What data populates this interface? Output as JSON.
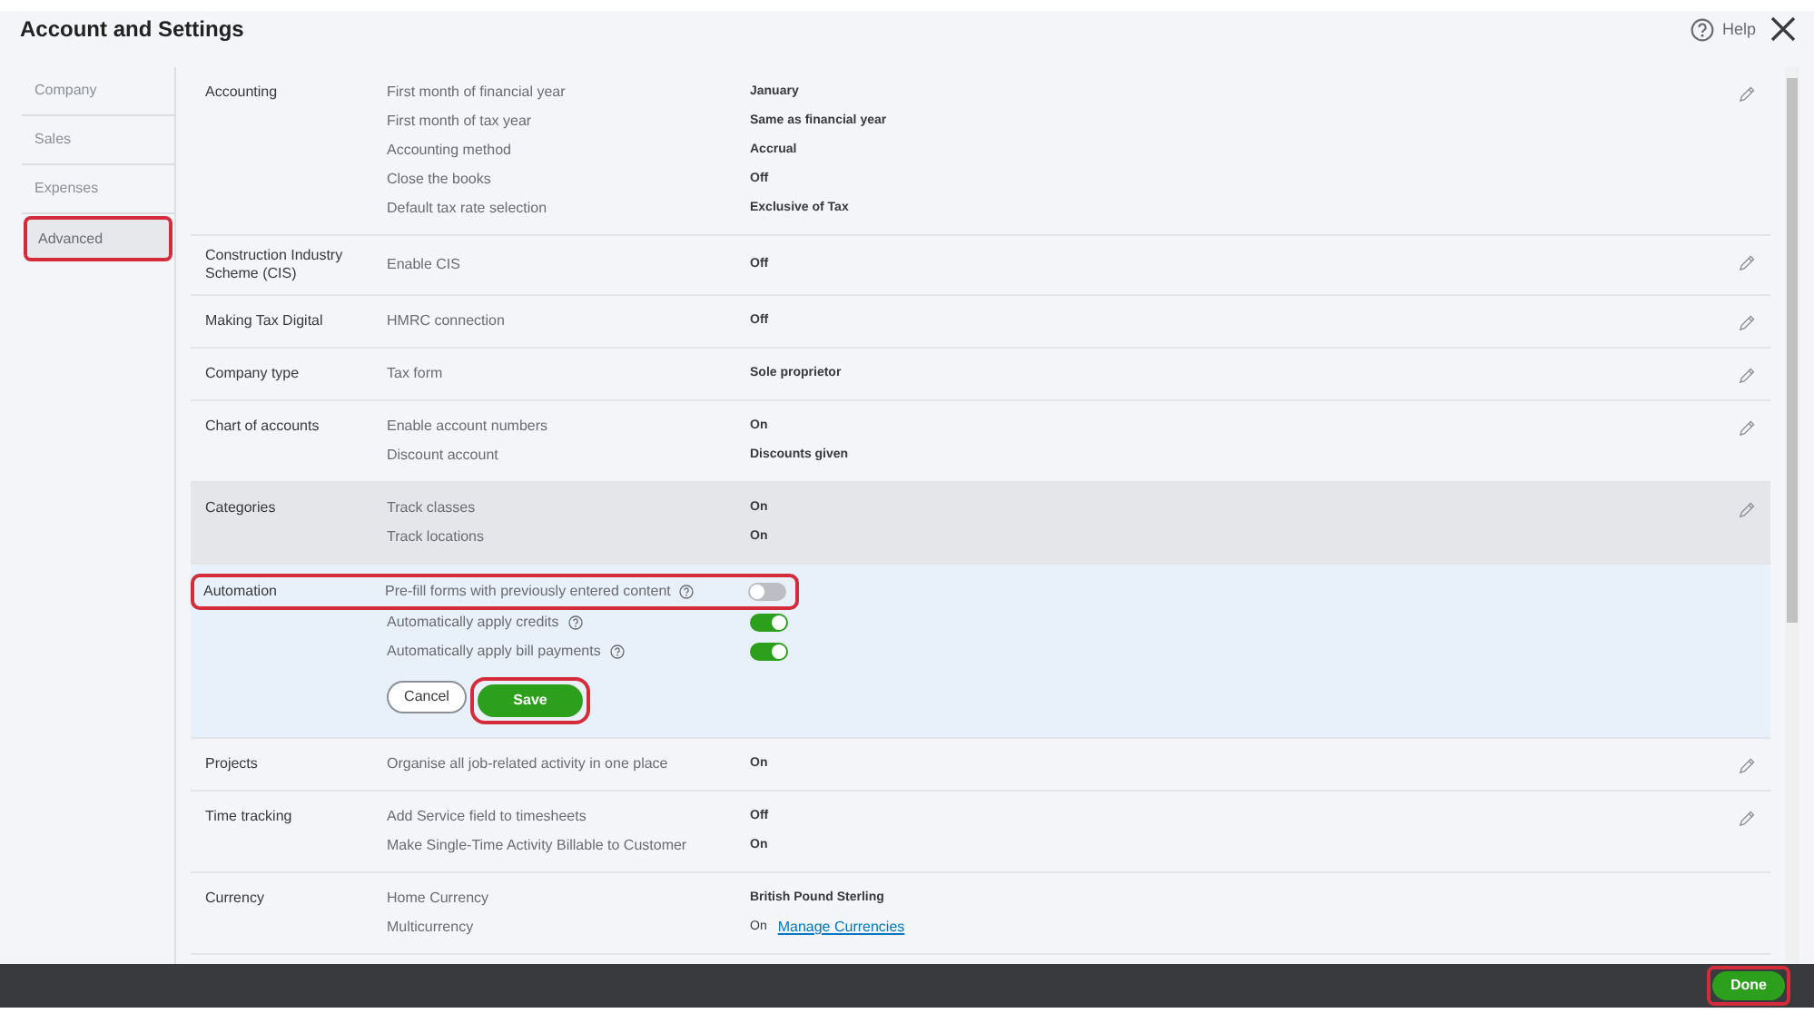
{
  "window": {
    "title": "Account and Settings",
    "help": "Help"
  },
  "sidebar": {
    "items": [
      {
        "label": "Company",
        "selected": false,
        "annotated": false
      },
      {
        "label": "Sales",
        "selected": false,
        "annotated": false
      },
      {
        "label": "Expenses",
        "selected": false,
        "annotated": false
      },
      {
        "label": "Advanced",
        "selected": true,
        "annotated": true
      }
    ]
  },
  "sections": [
    {
      "title": "Accounting",
      "hovered": false,
      "editing": false,
      "editable": true,
      "rows": [
        {
          "kind": "value",
          "label": "First month of financial year",
          "value": "January"
        },
        {
          "kind": "value",
          "label": "First month of tax year",
          "value": "Same as financial year"
        },
        {
          "kind": "value",
          "label": "Accounting method",
          "value": "Accrual"
        },
        {
          "kind": "value",
          "label": "Close the books",
          "value": "Off"
        },
        {
          "kind": "value",
          "label": "Default tax rate selection",
          "value": "Exclusive of Tax"
        }
      ]
    },
    {
      "title": "Construction Industry Scheme (CIS)",
      "hovered": false,
      "editing": false,
      "editable": true,
      "rows": [
        {
          "kind": "value",
          "label": "Enable CIS",
          "value": "Off"
        }
      ]
    },
    {
      "title": "Making Tax Digital",
      "hovered": false,
      "editing": false,
      "editable": true,
      "rows": [
        {
          "kind": "value",
          "label": "HMRC connection",
          "value": "Off"
        }
      ]
    },
    {
      "title": "Company type",
      "hovered": false,
      "editing": false,
      "editable": true,
      "rows": [
        {
          "kind": "value",
          "label": "Tax form",
          "value": "Sole proprietor"
        }
      ]
    },
    {
      "title": "Chart of accounts",
      "hovered": false,
      "editing": false,
      "editable": true,
      "rows": [
        {
          "kind": "value",
          "label": "Enable account numbers",
          "value": "On"
        },
        {
          "kind": "value",
          "label": "Discount account",
          "value": "Discounts given"
        }
      ]
    },
    {
      "title": "Categories",
      "hovered": true,
      "editing": false,
      "editable": true,
      "rows": [
        {
          "kind": "value",
          "label": "Track classes",
          "value": "On"
        },
        {
          "kind": "value",
          "label": "Track locations",
          "value": "On"
        }
      ]
    },
    {
      "title": "Automation",
      "hovered": false,
      "editing": true,
      "editable": false,
      "rows": [
        {
          "kind": "toggle",
          "label": "Pre-fill forms with previously entered content",
          "on": false,
          "annotated": true
        },
        {
          "kind": "toggle",
          "label": "Automatically apply credits",
          "on": true,
          "annotated": false
        },
        {
          "kind": "toggle",
          "label": "Automatically apply bill payments",
          "on": true,
          "annotated": false
        }
      ],
      "actions": [
        {
          "label": "Cancel",
          "kind": "secondary",
          "annotated": false
        },
        {
          "label": "Save",
          "kind": "primary",
          "annotated": true
        }
      ]
    },
    {
      "title": "Projects",
      "hovered": false,
      "editing": false,
      "editable": true,
      "rows": [
        {
          "kind": "value",
          "label": "Organise all job-related activity in one place",
          "value": "On"
        }
      ]
    },
    {
      "title": "Time tracking",
      "hovered": false,
      "editing": false,
      "editable": true,
      "rows": [
        {
          "kind": "value",
          "label": "Add Service field to timesheets",
          "value": "Off"
        },
        {
          "kind": "value",
          "label": "Make Single-Time Activity Billable to Customer",
          "value": "On"
        }
      ]
    },
    {
      "title": "Currency",
      "hovered": false,
      "editing": false,
      "editable": false,
      "rows": [
        {
          "kind": "value",
          "label": "Home Currency",
          "value": "British Pound Sterling"
        },
        {
          "kind": "value",
          "label": "Multicurrency",
          "value": "On",
          "link": "Manage Currencies"
        }
      ]
    }
  ],
  "footer": {
    "done": {
      "label": "Done",
      "annotated": true
    }
  }
}
